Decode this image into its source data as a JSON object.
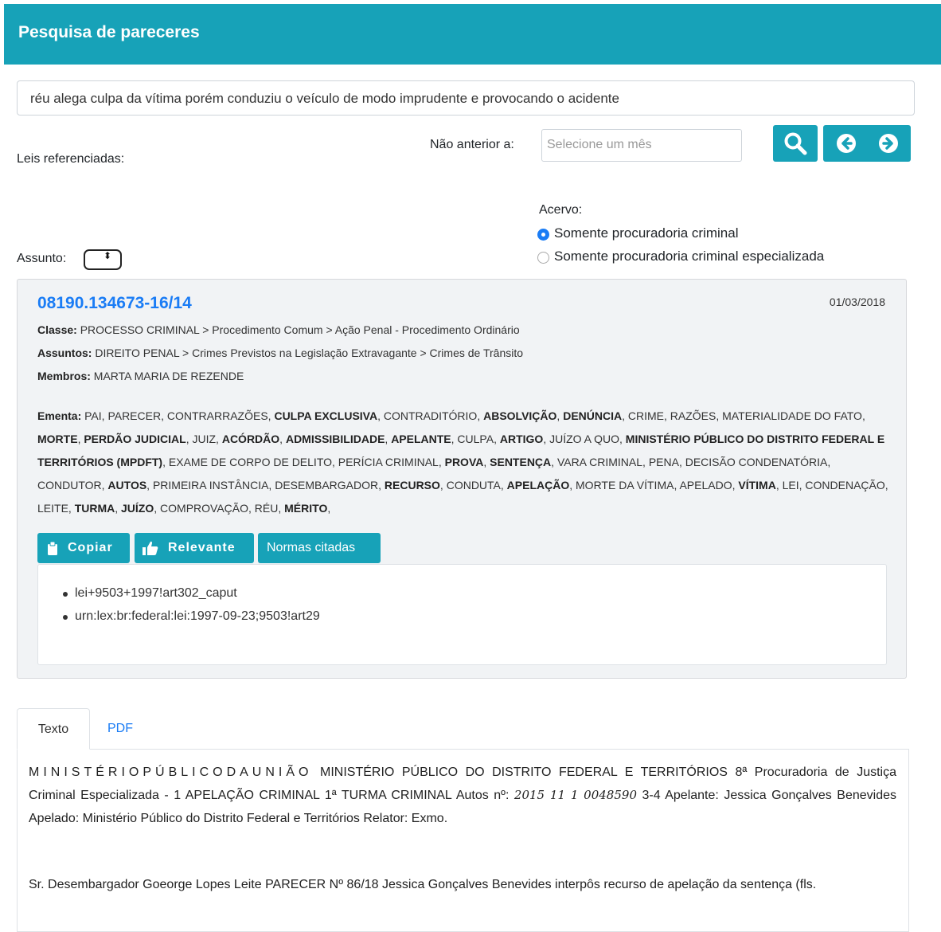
{
  "header": {
    "title": "Pesquisa de pareceres"
  },
  "search": {
    "query": "réu alega culpa da vítima porém conduziu o veículo de modo imprudente e provocando o acidente"
  },
  "filters": {
    "leis_label": "Leis referenciadas:",
    "nao_anterior_label": "Não anterior a:",
    "month_placeholder": "Selecione um mês",
    "acervo_label": "Acervo:",
    "acervo_options": [
      {
        "label": "Somente procuradoria criminal",
        "checked": true
      },
      {
        "label": "Somente procuradoria criminal especializada",
        "checked": false
      }
    ],
    "assunto_label": "Assunto:",
    "assunto_arrows": "⬍"
  },
  "toolbar": {
    "search_icon": "search-icon",
    "prev_icon": "arrow-left-circle-icon",
    "next_icon": "arrow-right-circle-icon"
  },
  "result": {
    "id": "08190.134673-16/14",
    "date": "01/03/2018",
    "classe_label": "Classe:",
    "classe": "PROCESSO CRIMINAL > Procedimento Comum > Ação Penal - Procedimento Ordinário",
    "assuntos_label": "Assuntos:",
    "assuntos": "DIREITO PENAL > Crimes Previstos na Legislação Extravagante > Crimes de Trânsito",
    "membros_label": "Membros:",
    "membros": "MARTA MARIA DE REZENDE",
    "ementa_label": "Ementa:",
    "ementa_terms": [
      {
        "text": "PAI",
        "bold": false
      },
      {
        "text": "PARECER",
        "bold": false
      },
      {
        "text": "CONTRARRAZÕES",
        "bold": false
      },
      {
        "text": "CULPA EXCLUSIVA",
        "bold": true
      },
      {
        "text": "CONTRADITÓRIO",
        "bold": false
      },
      {
        "text": "ABSOLVIÇÃO",
        "bold": true
      },
      {
        "text": "DENÚNCIA",
        "bold": true
      },
      {
        "text": "CRIME",
        "bold": false
      },
      {
        "text": "RAZÕES",
        "bold": false
      },
      {
        "text": "MATERIALIDADE DO FATO",
        "bold": false
      },
      {
        "text": "MORTE",
        "bold": true
      },
      {
        "text": "PERDÃO JUDICIAL",
        "bold": true
      },
      {
        "text": "JUIZ",
        "bold": false
      },
      {
        "text": "ACÓRDÃO",
        "bold": true
      },
      {
        "text": "ADMISSIBILIDADE",
        "bold": true
      },
      {
        "text": "APELANTE",
        "bold": true
      },
      {
        "text": "CULPA",
        "bold": false
      },
      {
        "text": "ARTIGO",
        "bold": true
      },
      {
        "text": "JUÍZO A QUO",
        "bold": false
      },
      {
        "text": "MINISTÉRIO PÚBLICO DO DISTRITO FEDERAL E TERRITÓRIOS (MPDFT)",
        "bold": true
      },
      {
        "text": "EXAME DE CORPO DE DELITO",
        "bold": false
      },
      {
        "text": "PERÍCIA CRIMINAL",
        "bold": false
      },
      {
        "text": "PROVA",
        "bold": true
      },
      {
        "text": "SENTENÇA",
        "bold": true
      },
      {
        "text": "VARA CRIMINAL",
        "bold": false
      },
      {
        "text": "PENA",
        "bold": false
      },
      {
        "text": "DECISÃO CONDENATÓRIA",
        "bold": false
      },
      {
        "text": "CONDUTOR",
        "bold": false
      },
      {
        "text": "AUTOS",
        "bold": true
      },
      {
        "text": "PRIMEIRA INSTÂNCIA",
        "bold": false
      },
      {
        "text": "DESEMBARGADOR",
        "bold": false
      },
      {
        "text": "RECURSO",
        "bold": true
      },
      {
        "text": "CONDUTA",
        "bold": false
      },
      {
        "text": "APELAÇÃO",
        "bold": true
      },
      {
        "text": "MORTE DA VÍTIMA",
        "bold": false
      },
      {
        "text": "APELADO",
        "bold": false
      },
      {
        "text": "VÍTIMA",
        "bold": true
      },
      {
        "text": "LEI",
        "bold": false
      },
      {
        "text": "CONDENAÇÃO",
        "bold": false
      },
      {
        "text": "LEITE",
        "bold": false
      },
      {
        "text": "TURMA",
        "bold": true
      },
      {
        "text": "JUÍZO",
        "bold": true
      },
      {
        "text": "COMPROVAÇÃO",
        "bold": false
      },
      {
        "text": "RÉU",
        "bold": false
      },
      {
        "text": "MÉRITO",
        "bold": true
      }
    ],
    "buttons": {
      "copiar": "Copiar",
      "relevante": "Relevante",
      "normas": "Normas citadas"
    },
    "normas": [
      "lei+9503+1997!art302_caput",
      "urn:lex:br:federal:lei:1997-09-23;9503!art29"
    ]
  },
  "tabs": {
    "texto": "Texto",
    "pdf": "PDF"
  },
  "document": {
    "spaced_heading": "MINISTÉRIOPÚBLICODAUNIÃO",
    "para1_a": " MINISTÉRIO PÚBLICO DO DISTRITO FEDERAL E TERRITÓRIOS 8ª Procuradoria de Justiça Criminal Especializada - 1 APELAÇÃO CRIMINAL 1ª TURMA CRIMINAL Autos nº: ",
    "para1_script": "2015 11 1 0048590",
    "para1_b": " 3-4 Apelante: Jessica Gonçalves Benevides Apelado: Ministério Público do Distrito Federal e Territórios Relator: Exmo.",
    "para2": "Sr. Desembargador Goeorge Lopes Leite PARECER Nº 86/18 Jessica Gonçalves Benevides interpôs recurso de apelação da sentença (fls."
  }
}
